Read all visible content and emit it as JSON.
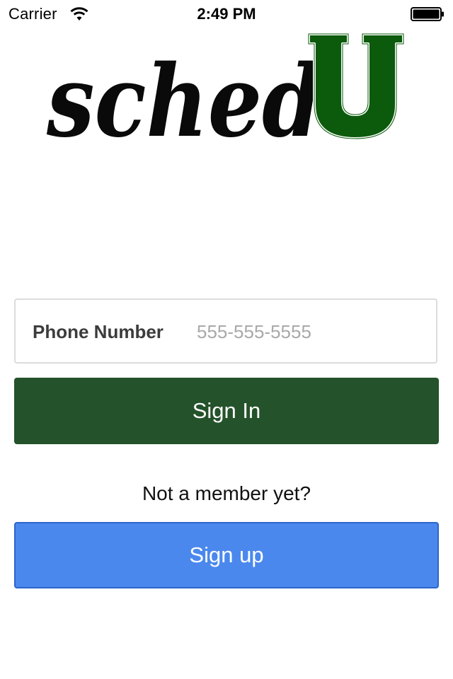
{
  "status_bar": {
    "carrier": "Carrier",
    "time": "2:49 PM",
    "wifi_icon": "wifi-icon",
    "battery_icon": "battery-icon"
  },
  "logo": {
    "text_script": "sched",
    "text_block": "U",
    "colors": {
      "script": "#0a0a0a",
      "block": "#0c5a0c"
    }
  },
  "login": {
    "phone_label": "Phone Number",
    "phone_placeholder": "555-555-5555",
    "phone_value": "",
    "signin_label": "Sign In",
    "not_member_text": "Not a member yet?",
    "signup_label": "Sign up"
  },
  "colors": {
    "signin_bg": "#24522a",
    "signup_bg": "#4a88ed",
    "signup_border": "#2d65cc",
    "field_border": "#dcdcdc",
    "placeholder": "#a9a9a9"
  }
}
